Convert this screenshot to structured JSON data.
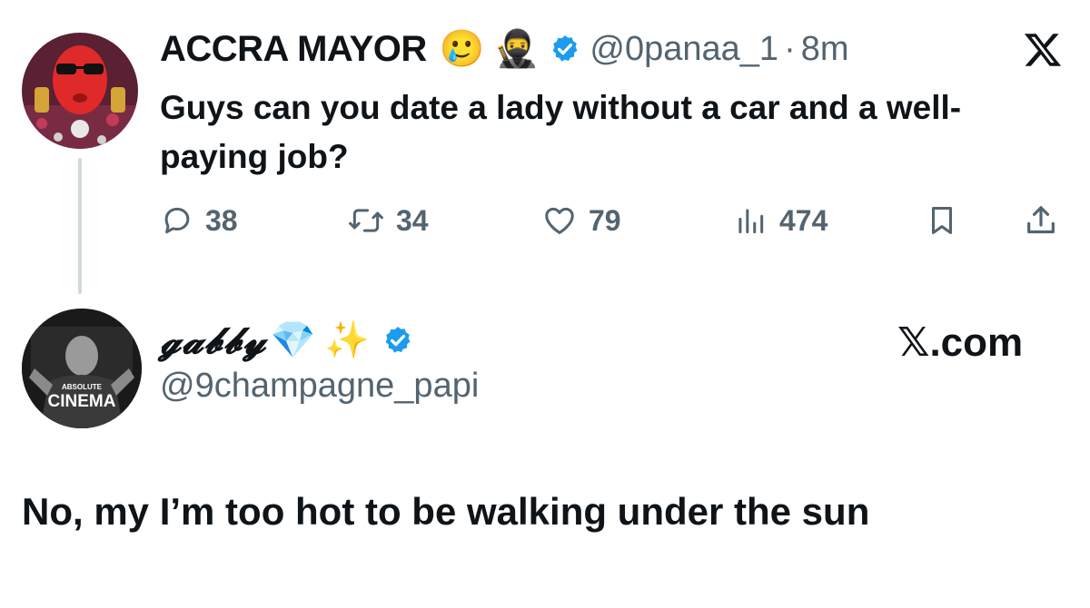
{
  "tweet": {
    "author_name": "ACCRA MAYOR",
    "author_emojis": [
      "🥲",
      "🥷"
    ],
    "handle": "@0panaa_1",
    "separator": "·",
    "time": "8m",
    "text": "Guys can you date a lady without a car and a well-paying job?",
    "stats": {
      "replies": "38",
      "reposts": "34",
      "likes": "79",
      "views": "474"
    }
  },
  "reply": {
    "author_name": "𝓰𝓪𝓫𝓫𝔂",
    "author_emojis": [
      "💎",
      "✨"
    ],
    "handle": "@9champagne_papi",
    "source": "𝕏.com",
    "avatar_caption_small": "ABSOLUTE",
    "avatar_caption": "CINEMA",
    "text": "No, my I’m too hot to be walking under the sun"
  },
  "colors": {
    "verified": "#1d9bf0",
    "muted": "#536471",
    "text": "#0f1419",
    "thread_line": "#cfd9de"
  },
  "icons": [
    "verified-badge-icon",
    "x-logo-icon",
    "reply-icon",
    "repost-icon",
    "like-icon",
    "views-icon",
    "bookmark-icon",
    "share-icon"
  ]
}
